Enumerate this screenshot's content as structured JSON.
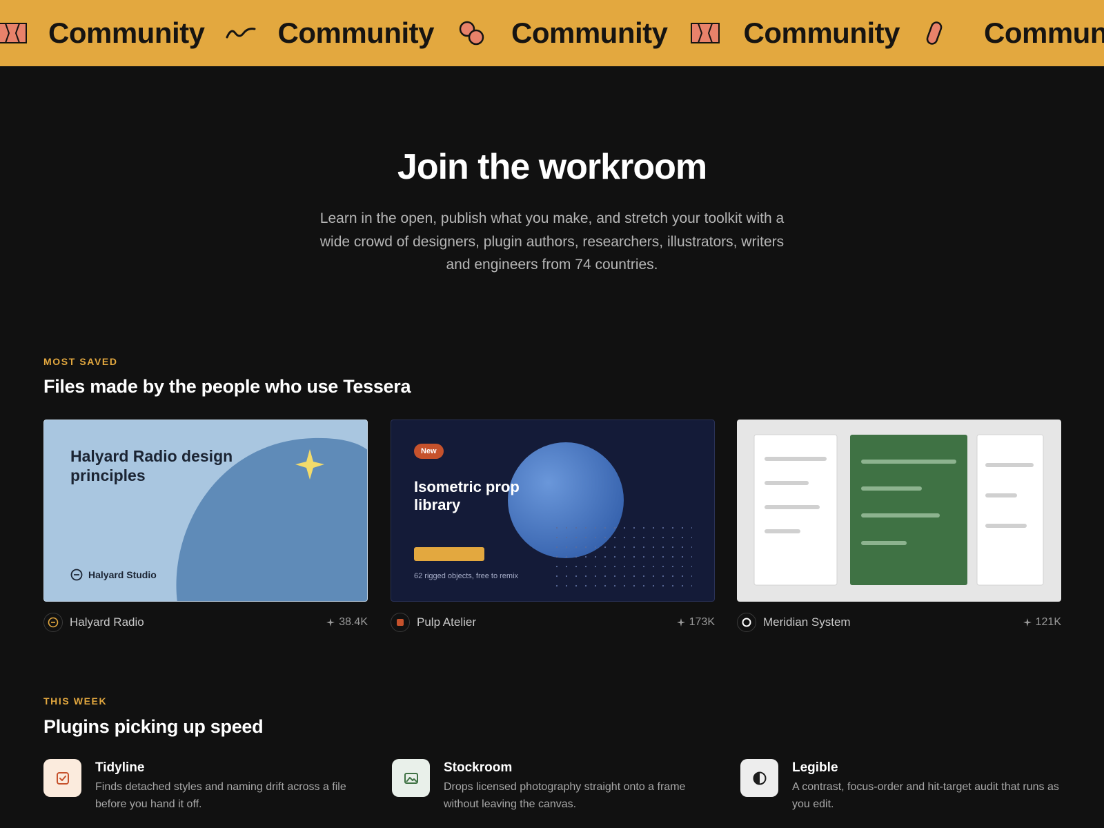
{
  "banner": {
    "word": "Community",
    "items": [
      {
        "label": "Community",
        "icon": "wave-icon"
      },
      {
        "label": "Community",
        "icon": "double-circle-icon"
      },
      {
        "label": "Community",
        "icon": "bowtie-icon"
      },
      {
        "label": "Community",
        "icon": "pill-icon"
      },
      {
        "label": "Community",
        "icon": "wave-icon"
      }
    ]
  },
  "hero": {
    "title": "Join the workroom",
    "subtitle": "Learn in the open, publish what you make, and stretch your toolkit with a wide crowd of designers, plugin authors, researchers, illustrators, writers and engineers from 74 countries."
  },
  "files_section": {
    "eyebrow": "MOST SAVED",
    "title": "Files made by the people who use Tessera",
    "cards": [
      {
        "preview_title": "Halyard Radio design principles",
        "preview_studio": "Halyard Studio",
        "author": "Halyard Radio",
        "saves": "38.4K",
        "accent": "#5F8BB8"
      },
      {
        "badge": "New",
        "preview_title": "Isometric prop library",
        "preview_caption": "62 rigged objects, free to remix",
        "author": "Pulp Atelier",
        "saves": "173K",
        "accent": "#141B38"
      },
      {
        "author": "Meridian System",
        "saves": "121K",
        "accent": "#3F7244"
      }
    ]
  },
  "plugins_section": {
    "eyebrow": "THIS WEEK",
    "title": "Plugins picking up speed",
    "items": [
      {
        "name": "Tidyline",
        "description": "Finds detached styles and naming drift across a file before you hand it off.",
        "icon": "checkbox-icon"
      },
      {
        "name": "Stockroom",
        "description": "Drops licensed photography straight onto a frame without leaving the canvas.",
        "icon": "image-icon"
      },
      {
        "name": "Legible",
        "description": "A contrast, focus-order and hit-target audit that runs as you edit.",
        "icon": "contrast-icon"
      }
    ]
  },
  "colors": {
    "background": "#111111",
    "banner": "#E3A83F",
    "accent": "#E3A83F",
    "shape_fill": "#E8826A"
  }
}
